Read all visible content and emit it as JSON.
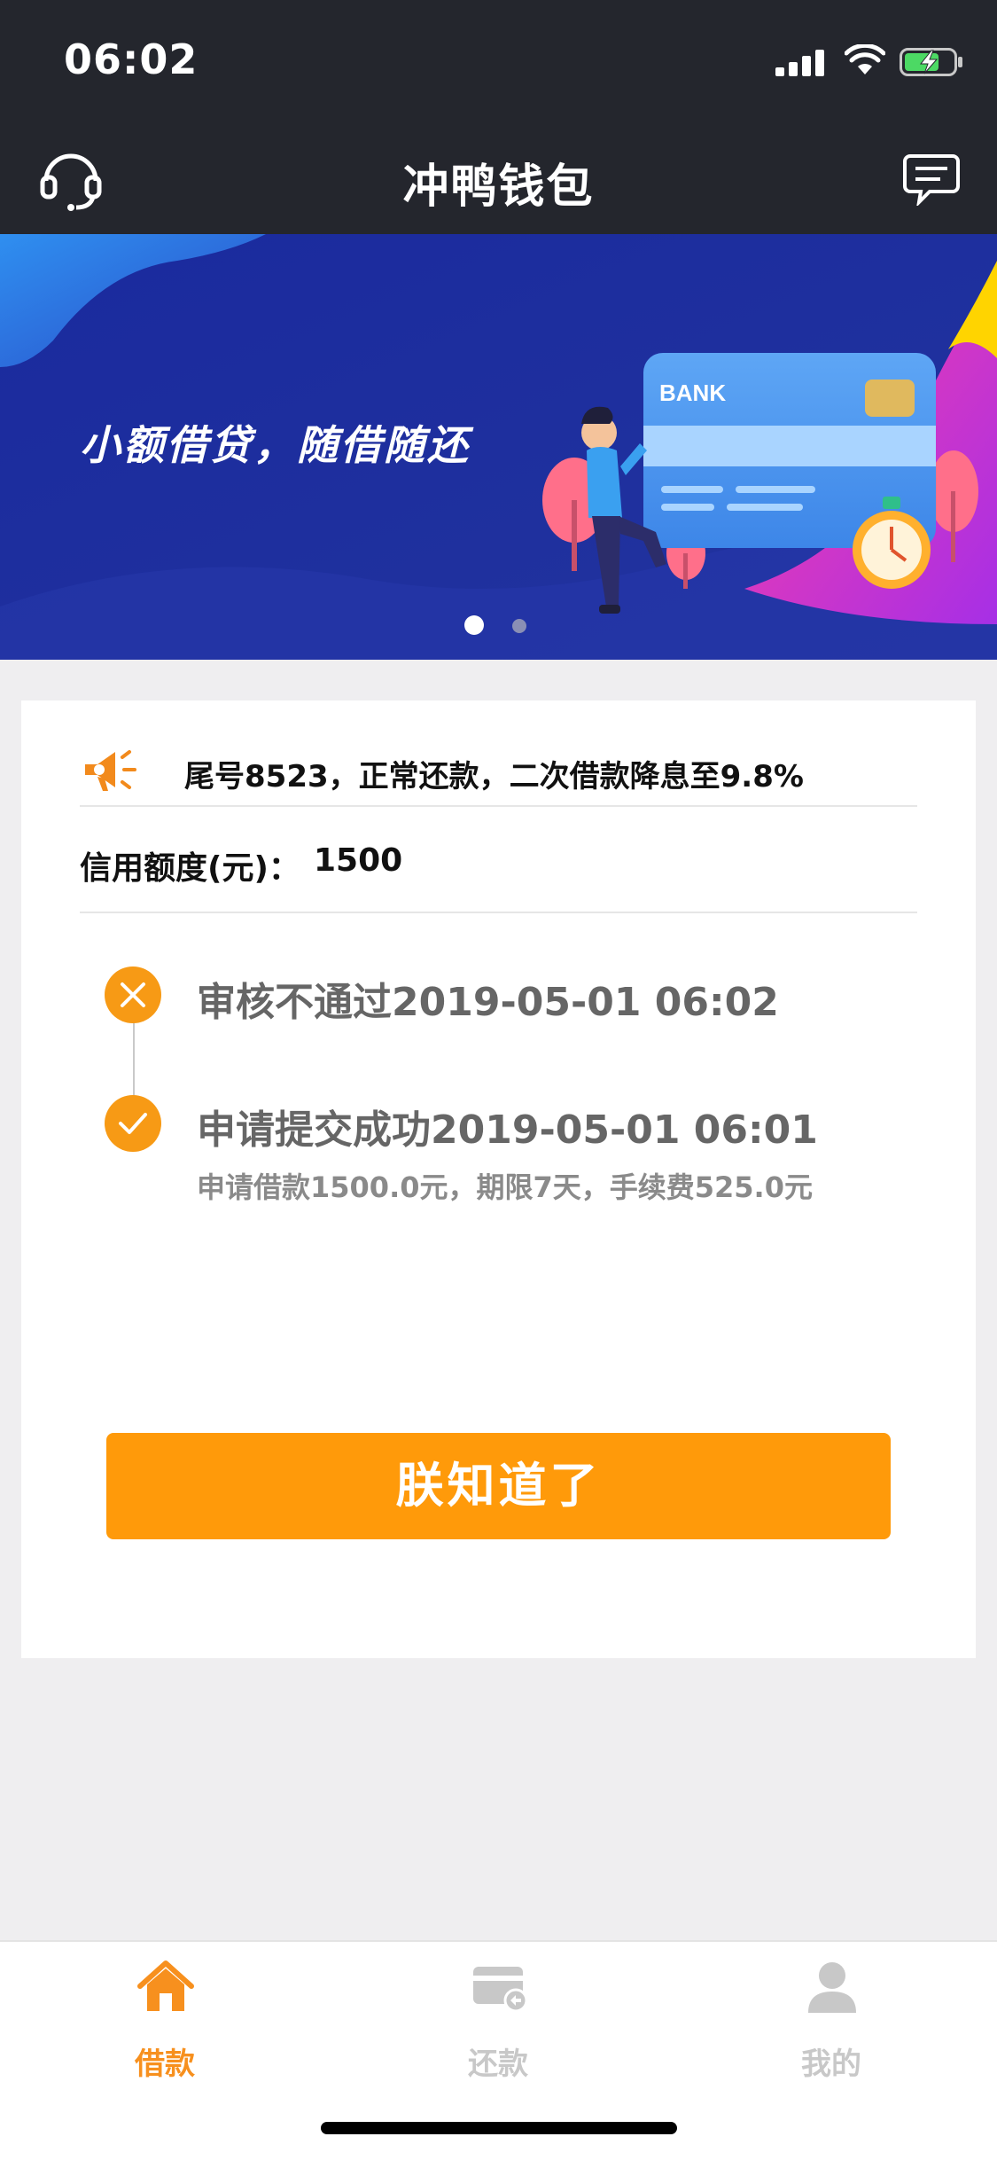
{
  "status_bar": {
    "time": "06:02"
  },
  "nav": {
    "title": "冲鸭钱包"
  },
  "banner": {
    "slogan": "小额借贷，随借随还",
    "card_label": "BANK"
  },
  "notice": {
    "text": "尾号8523，正常还款，二次借款降息至9.8%"
  },
  "credit": {
    "label": "信用额度(元)：",
    "value": "1500"
  },
  "timeline": [
    {
      "title": "审核不通过2019-05-01 06:02",
      "subtitle": ""
    },
    {
      "title": "申请提交成功2019-05-01 06:01",
      "subtitle": "申请借款1500.0元，期限7天，手续费525.0元"
    }
  ],
  "confirm_button": {
    "label": "朕知道了"
  },
  "tabs": [
    {
      "label": "借款",
      "icon": "home-icon",
      "active": true
    },
    {
      "label": "还款",
      "icon": "card-icon",
      "active": false
    },
    {
      "label": "我的",
      "icon": "person-icon",
      "active": false
    }
  ],
  "colors": {
    "accent": "#ff9a0a",
    "header": "#24262d",
    "tab_active": "#f7901e",
    "tab_inactive": "#c8c8c8"
  }
}
